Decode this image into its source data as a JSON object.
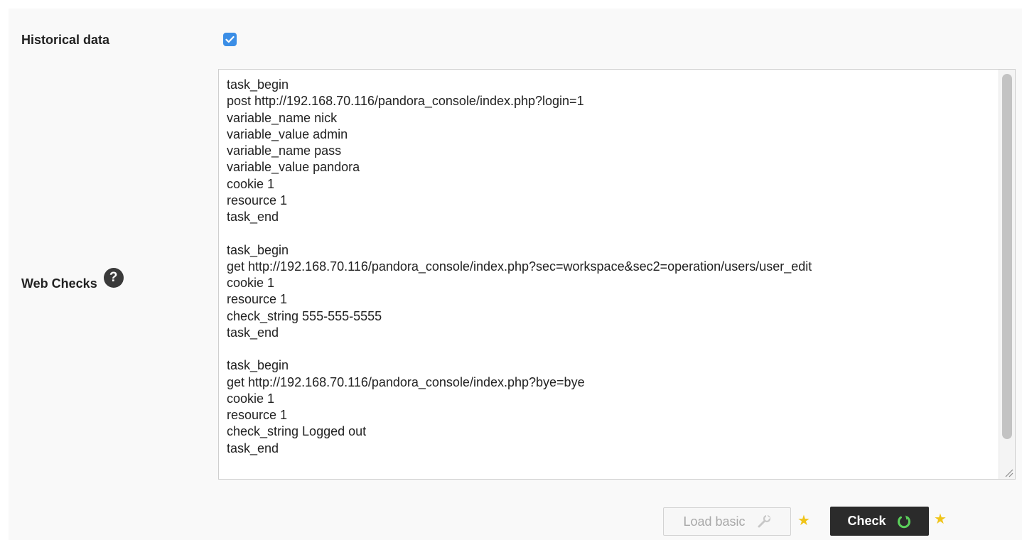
{
  "fields": {
    "historical_data_label": "Historical data",
    "historical_data_checked": true,
    "web_checks_label": "Web Checks",
    "help_icon_glyph": "?"
  },
  "web_checks_text": "task_begin\npost http://192.168.70.116/pandora_console/index.php?login=1\nvariable_name nick\nvariable_value admin\nvariable_name pass\nvariable_value pandora\ncookie 1\nresource 1\ntask_end\n\ntask_begin\nget http://192.168.70.116/pandora_console/index.php?sec=workspace&sec2=operation/users/user_edit\ncookie 1\nresource 1\ncheck_string 555-555-5555\ntask_end\n\ntask_begin\nget http://192.168.70.116/pandora_console/index.php?bye=bye\ncookie 1\nresource 1\ncheck_string Logged out\ntask_end",
  "buttons": {
    "load_basic_label": "Load basic",
    "load_basic_icon": "wrench-icon",
    "check_label": "Check",
    "check_icon": "refresh-icon"
  },
  "colors": {
    "checkbox": "#3b8ee6",
    "check_button_bg": "#2b2b2b",
    "refresh_icon": "#5bd15b",
    "star": "#f0c419"
  },
  "icons": {
    "star": "★"
  }
}
